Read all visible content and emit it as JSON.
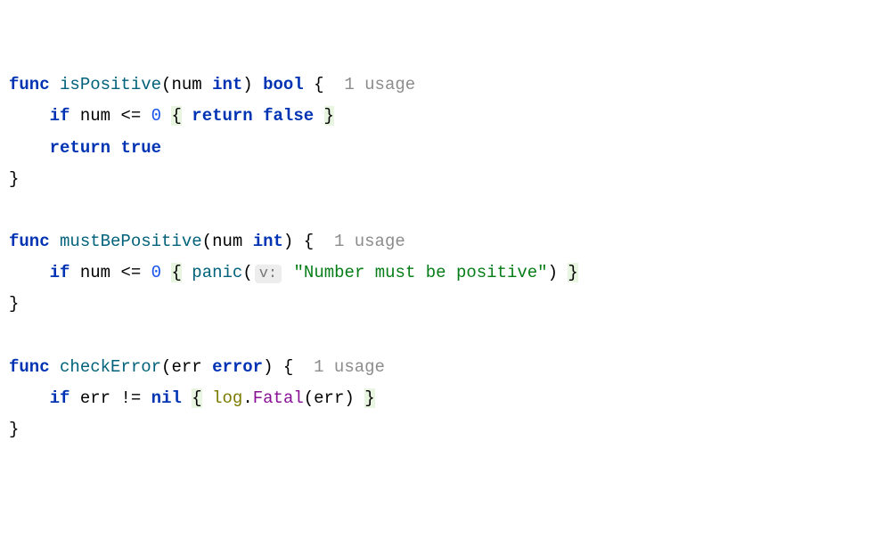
{
  "tokens": {
    "func": "func",
    "if": "if",
    "return": "return",
    "int": "int",
    "bool": "bool",
    "error": "error",
    "nil": "nil",
    "true": "true",
    "false": "false"
  },
  "functions": {
    "isPositive": "isPositive",
    "mustBePositive": "mustBePositive",
    "checkError": "checkError",
    "panic": "panic",
    "Fatal": "Fatal"
  },
  "params": {
    "num": "num",
    "err": "err"
  },
  "packages": {
    "log": "log"
  },
  "literals": {
    "zero": "0",
    "msg": "\"Number must be positive\""
  },
  "operators": {
    "lte": "<=",
    "neq": "!="
  },
  "hints": {
    "v": "v:"
  },
  "annotations": {
    "usage1": "1 usage"
  },
  "braces": {
    "open": "{",
    "close": "}",
    "lparen": "(",
    "rparen": ")"
  }
}
